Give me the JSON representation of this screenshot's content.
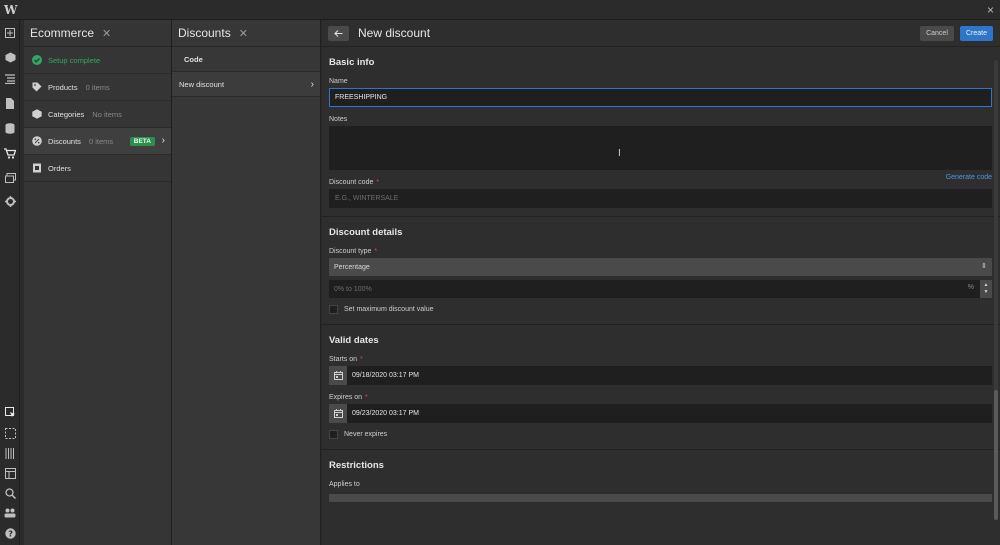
{
  "app": {
    "logo": "W",
    "close": "×"
  },
  "leftbar": {
    "icons": [
      "add-icon",
      "box-icon",
      "navigator-icon",
      "pages-icon",
      "cms-icon",
      "ecommerce-icon",
      "assets-icon",
      "settings-icon",
      "select-icon",
      "marquee-icon",
      "audit-icon",
      "layout-icon",
      "search-icon",
      "users-icon",
      "help-icon"
    ]
  },
  "ecommerce": {
    "title": "Ecommerce",
    "items": [
      {
        "label": "Setup complete",
        "sub": ""
      },
      {
        "label": "Products",
        "sub": "0 items"
      },
      {
        "label": "Categories",
        "sub": "No items"
      },
      {
        "label": "Discounts",
        "sub": "0 items",
        "badge": "BETA"
      },
      {
        "label": "Orders",
        "sub": ""
      }
    ]
  },
  "discounts": {
    "title": "Discounts",
    "column": "Code",
    "row": "New discount"
  },
  "main": {
    "title": "New discount",
    "cancel": "Cancel",
    "create": "Create",
    "basic": {
      "title": "Basic info",
      "name_label": "Name",
      "name_value": "FREESHIPPING",
      "notes_label": "Notes",
      "code_label": "Discount code",
      "generate": "Generate code",
      "code_placeholder": "E.G., WINTERSALE"
    },
    "details": {
      "title": "Discount details",
      "type_label": "Discount type",
      "type_value": "Percentage",
      "amount_placeholder": "0% to 100%",
      "amount_unit": "%",
      "max_label": "Set maximum discount value"
    },
    "dates": {
      "title": "Valid dates",
      "starts_label": "Starts on",
      "starts_value": "09/18/2020 03:17 PM",
      "expires_label": "Expires on",
      "expires_value": "09/23/2020 03:17 PM",
      "never_label": "Never expires"
    },
    "restrictions": {
      "title": "Restrictions",
      "applies_label": "Applies to"
    }
  }
}
